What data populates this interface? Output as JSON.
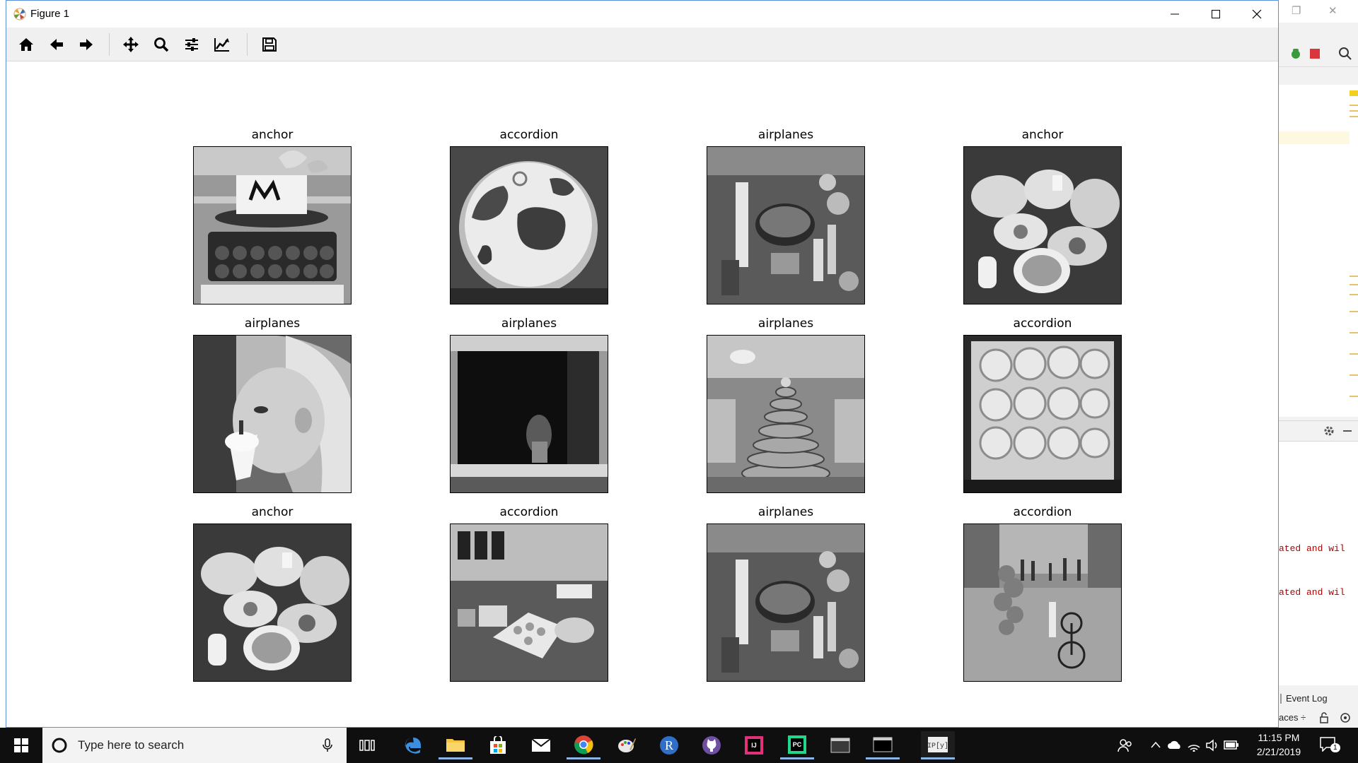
{
  "window": {
    "title": "Figure 1",
    "controls": {
      "minimize": "minimize",
      "maximize": "maximize",
      "close": "close"
    }
  },
  "toolbar": {
    "buttons": [
      {
        "name": "home-icon",
        "tooltip": "Reset original view"
      },
      {
        "name": "back-arrow-icon",
        "tooltip": "Back to previous view"
      },
      {
        "name": "forward-arrow-icon",
        "tooltip": "Forward to next view"
      },
      {
        "name": "pan-move-icon",
        "tooltip": "Pan axes"
      },
      {
        "name": "zoom-magnifier-icon",
        "tooltip": "Zoom to rectangle"
      },
      {
        "name": "subplots-config-icon",
        "tooltip": "Configure subplots"
      },
      {
        "name": "edit-axes-icon",
        "tooltip": "Edit axis, curve and image parameters"
      },
      {
        "name": "save-floppy-icon",
        "tooltip": "Save the figure"
      }
    ]
  },
  "figure": {
    "panels": [
      {
        "title": "anchor",
        "content": "cake-tier"
      },
      {
        "title": "accordion",
        "content": "cupcake-closeup"
      },
      {
        "title": "airplanes",
        "content": "table-spread"
      },
      {
        "title": "anchor",
        "content": "food-plates"
      },
      {
        "title": "airplanes",
        "content": "girl-icecream"
      },
      {
        "title": "airplanes",
        "content": "dark-window"
      },
      {
        "title": "airplanes",
        "content": "cupcake-tower"
      },
      {
        "title": "accordion",
        "content": "cupcake-box"
      },
      {
        "title": "anchor",
        "content": "food-plates"
      },
      {
        "title": "accordion",
        "content": "dessert-table"
      },
      {
        "title": "airplanes",
        "content": "table-spread"
      },
      {
        "title": "accordion",
        "content": "street-bicycle"
      }
    ]
  },
  "ide": {
    "console_lines": [
      "ated and wil",
      "ated and wil"
    ],
    "event_log": "Event Log",
    "bottom_text": "aces ÷"
  },
  "taskbar": {
    "search_placeholder": "Type here to search",
    "apps": [
      "task-view-icon",
      "edge-icon",
      "file-explorer-icon",
      "store-icon",
      "mail-icon",
      "chrome-icon",
      "paint-icon",
      "r-icon",
      "github-icon",
      "intellij-icon",
      "pycharm-icon",
      "terminal-icon",
      "cmd-icon",
      "ipython-icon"
    ],
    "time": "11:15 PM",
    "date": "2/21/2019",
    "notification_count": "1"
  },
  "colors": {
    "taskbar_bg": "#0f0f0f",
    "toolbar_bg": "#f0f0f0",
    "window_border": "#5b8fd8",
    "console_warn": "#b00000"
  }
}
